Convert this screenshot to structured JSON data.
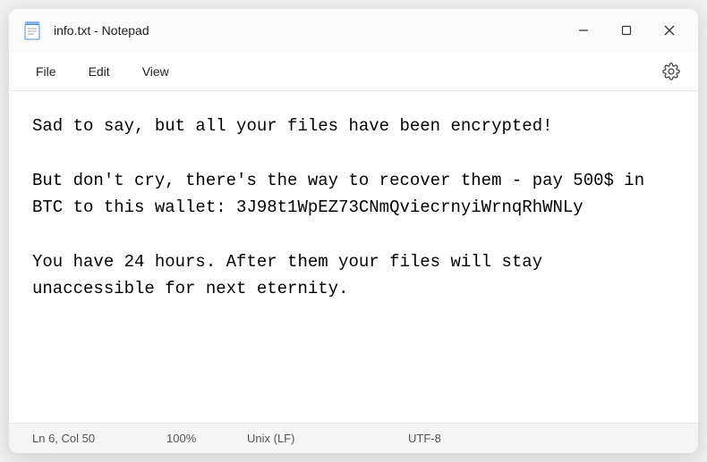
{
  "window": {
    "title": "info.txt - Notepad"
  },
  "menu": {
    "file": "File",
    "edit": "Edit",
    "view": "View"
  },
  "content": {
    "text": "Sad to say, but all your files have been encrypted!\n\nBut don't cry, there's the way to recover them - pay 500$ in BTC to this wallet: 3J98t1WpEZ73CNmQviecrnyiWrnqRhWNLy\n\nYou have 24 hours. After them your files will stay unaccessible for next eternity."
  },
  "status": {
    "position": "Ln 6, Col 50",
    "zoom": "100%",
    "eol": "Unix (LF)",
    "encoding": "UTF-8"
  }
}
